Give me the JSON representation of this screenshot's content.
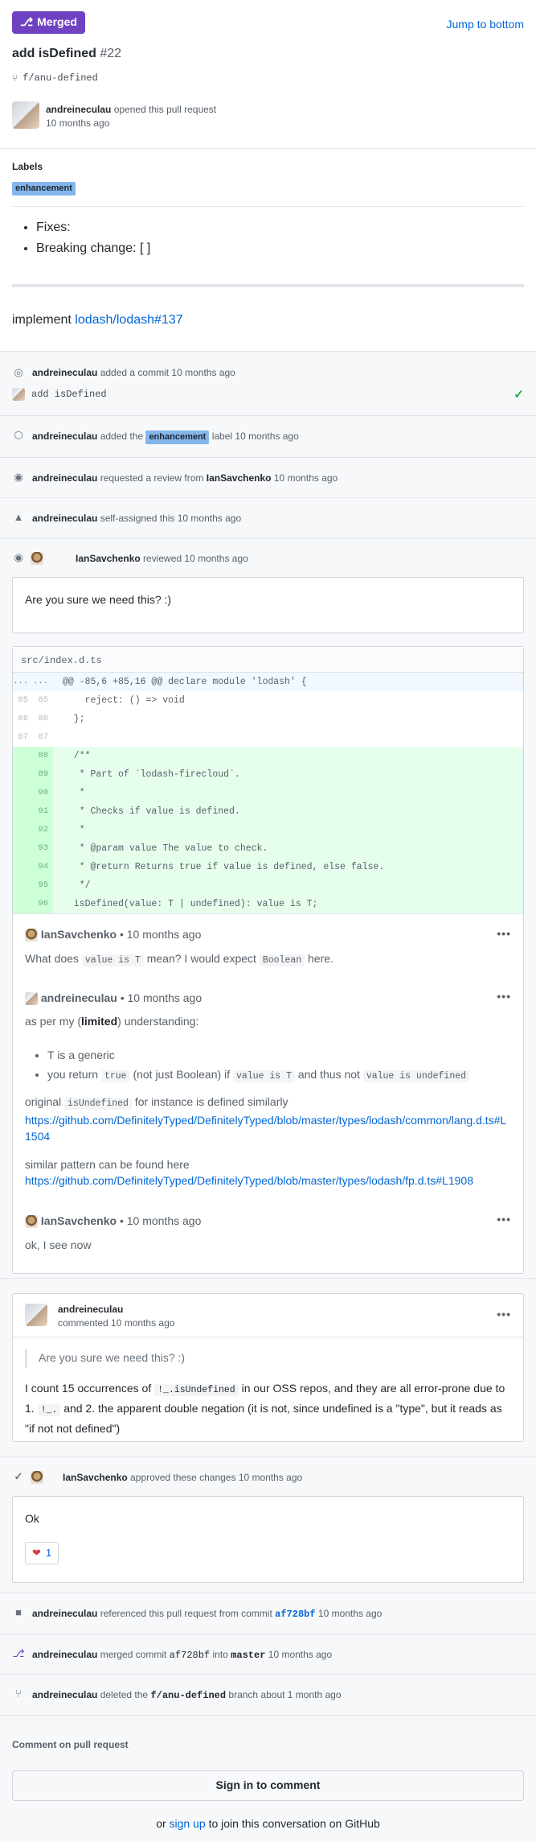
{
  "header": {
    "state_label": "Merged",
    "jump_label": "Jump to bottom"
  },
  "pr": {
    "title": "add isDefined",
    "number": "#22",
    "branch": "f/anu-defined"
  },
  "opener": {
    "user": "andreineculau",
    "action": "opened this pull request",
    "when": "10 months ago"
  },
  "labels": {
    "heading": "Labels",
    "items": [
      "enhancement"
    ]
  },
  "description": {
    "items": [
      "Fixes:",
      "Breaking change: [ ]"
    ],
    "implement_prefix": "implement",
    "implement_link": "lodash/lodash#137"
  },
  "timeline": {
    "commit_event": {
      "user": "andreineculau",
      "text": "added a commit 10 months ago",
      "commit_msg": "add isDefined"
    },
    "label_event": {
      "user": "andreineculau",
      "pre": "added the",
      "label": "enhancement",
      "post": "label 10 months ago"
    },
    "review_request": {
      "user": "andreineculau",
      "pre": "requested a review from",
      "reviewer": "IanSavchenko",
      "post": "10 months ago"
    },
    "self_assign": {
      "user": "andreineculau",
      "text": "self-assigned this 10 months ago"
    },
    "reviewed": {
      "user": "IanSavchenko",
      "text": "reviewed 10 months ago"
    }
  },
  "review": {
    "body": "Are you sure we need this? :)",
    "file": "src/index.d.ts",
    "hunk": "@@ -85,6 +85,16 @@ declare module 'lodash' {",
    "context_lines": [
      {
        "old": "85",
        "new": "85",
        "code": "    reject: () => void"
      },
      {
        "old": "86",
        "new": "86",
        "code": "  };"
      },
      {
        "old": "87",
        "new": "87",
        "code": ""
      }
    ],
    "added_lines": [
      {
        "new": "88",
        "code": "  /**"
      },
      {
        "new": "89",
        "code": "   * Part of `lodash-firecloud`."
      },
      {
        "new": "90",
        "code": "   *"
      },
      {
        "new": "91",
        "code": "   * Checks if value is defined."
      },
      {
        "new": "92",
        "code": "   *"
      },
      {
        "new": "93",
        "code": "   * @param value The value to check."
      },
      {
        "new": "94",
        "code": "   * @return Returns true if value is defined, else false."
      },
      {
        "new": "95",
        "code": "   */"
      },
      {
        "new": "96",
        "code": "  isDefined(value: T | undefined): value is T;"
      }
    ],
    "thread": {
      "c1": {
        "user": "IanSavchenko",
        "when": "• 10 months ago",
        "t1": "What does",
        "code1": "value is T",
        "t2": "mean? I would expect",
        "code2": "Boolean",
        "t3": "here."
      },
      "c2": {
        "user": "andreineculau",
        "when": "• 10 months ago",
        "intro_a": "as per my (",
        "intro_b": "limited",
        "intro_c": ") understanding:",
        "b1": "T is a generic",
        "b2_a": "you return",
        "b2_code1": "true",
        "b2_b": "(not just Boolean) if",
        "b2_code2": "value is T",
        "b2_c": "and thus not",
        "b2_code3": "value is undefined",
        "p1_a": "original",
        "p1_code": "isUndefined",
        "p1_b": "for instance is defined similarly",
        "link1": "https://github.com/DefinitelyTyped/DefinitelyTyped/blob/master/types/lodash/common/lang.d.ts#L1504",
        "p2": "similar pattern can be found here",
        "link2": "https://github.com/DefinitelyTyped/DefinitelyTyped/blob/master/types/lodash/fp.d.ts#L1908"
      },
      "c3": {
        "user": "IanSavchenko",
        "when": "• 10 months ago",
        "text": "ok, I see now"
      }
    }
  },
  "comment": {
    "user": "andreineculau",
    "when": "commented 10 months ago",
    "quote": "Are you sure we need this? :)",
    "t1": "I count 15 occurrences of",
    "code1": "!_.isUndefined",
    "t2": "in our OSS repos, and they are all error-prone due to 1.",
    "code2": "!_.",
    "t3": "and 2. the apparent double negation (it is not, since undefined is a \"type\", but it reads as \"if not not defined\")"
  },
  "approval": {
    "user": "IanSavchenko",
    "text": "approved these changes 10 months ago",
    "body": "Ok",
    "reaction_count": "1"
  },
  "events": {
    "ref": {
      "user": "andreineculau",
      "pre": "referenced this pull request from commit",
      "sha": "af728bf",
      "post": "10 months ago"
    },
    "merge": {
      "user": "andreineculau",
      "pre": "merged commit",
      "sha": "af728bf",
      "mid": "into",
      "target": "master",
      "post": "10 months ago"
    },
    "delete": {
      "user": "andreineculau",
      "pre": "deleted the",
      "branch": "f/anu-defined",
      "post": "branch about 1 month ago"
    }
  },
  "footer": {
    "heading": "Comment on pull request",
    "signin": "Sign in to comment",
    "or": "or",
    "signup": "sign up",
    "rest": "to join this conversation on GitHub"
  },
  "colors": {
    "merged": "#6f42c1",
    "link": "#0366d6",
    "label": "#84b6eb",
    "add_bg": "#e6ffed",
    "approve_check": "#28a745"
  }
}
